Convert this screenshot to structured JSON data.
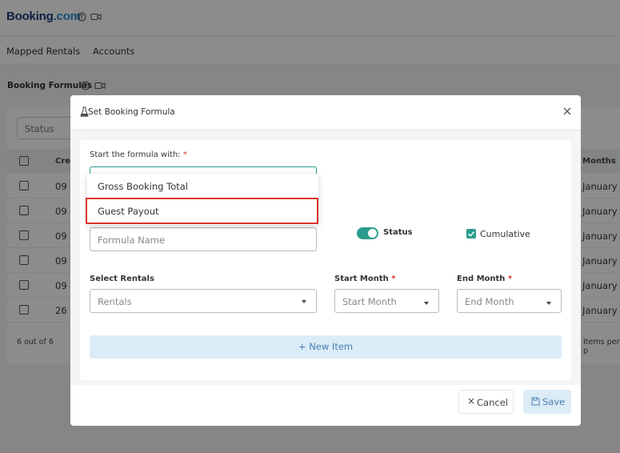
{
  "app": {
    "brand_part1": "Booking",
    "brand_part2": ".com"
  },
  "nav": {
    "items": [
      "Mapped Rentals",
      "Accounts"
    ]
  },
  "page": {
    "section_title": "Booking Formulas",
    "status_placeholder": "Status"
  },
  "table": {
    "headers": {
      "created": "Crea",
      "months": "Months"
    },
    "rows": [
      {
        "created": "09 -",
        "months": "January"
      },
      {
        "created": "09 -",
        "months": "January"
      },
      {
        "created": "09 -",
        "months": "January"
      },
      {
        "created": "09 -",
        "months": "January"
      },
      {
        "created": "09 -",
        "months": "January"
      },
      {
        "created": "26 -",
        "months": "January"
      }
    ],
    "count_text": "6 out of 6",
    "per_page_text": "Items per p"
  },
  "modal": {
    "title": "Set Booking Formula",
    "start_label": "Start the formula with:",
    "required_mark": "*",
    "dropdown_options": [
      "Gross Booking Total",
      "Guest Payout"
    ],
    "highlighted_option": "Guest Payout",
    "formula_name_placeholder": "Formula Name",
    "status_label": "Status",
    "status_on": true,
    "cumulative_label": "Cumulative",
    "cumulative_checked": true,
    "select_rentals_label": "Select Rentals",
    "rentals_placeholder": "Rentals",
    "start_month_label": "Start Month",
    "start_month_placeholder": "Start Month",
    "end_month_label": "End Month",
    "end_month_placeholder": "End Month",
    "new_item_label": "New Item",
    "cancel_label": "Cancel",
    "save_label": "Save"
  },
  "colors": {
    "accent": "#2a9d8f",
    "brand_dark": "#1b3d7a",
    "brand_light": "#2a8fd6",
    "highlight": "#d9342b"
  },
  "icons": [
    "help-icon",
    "video-icon",
    "flask-icon",
    "close-icon",
    "plus-icon",
    "save-icon"
  ]
}
